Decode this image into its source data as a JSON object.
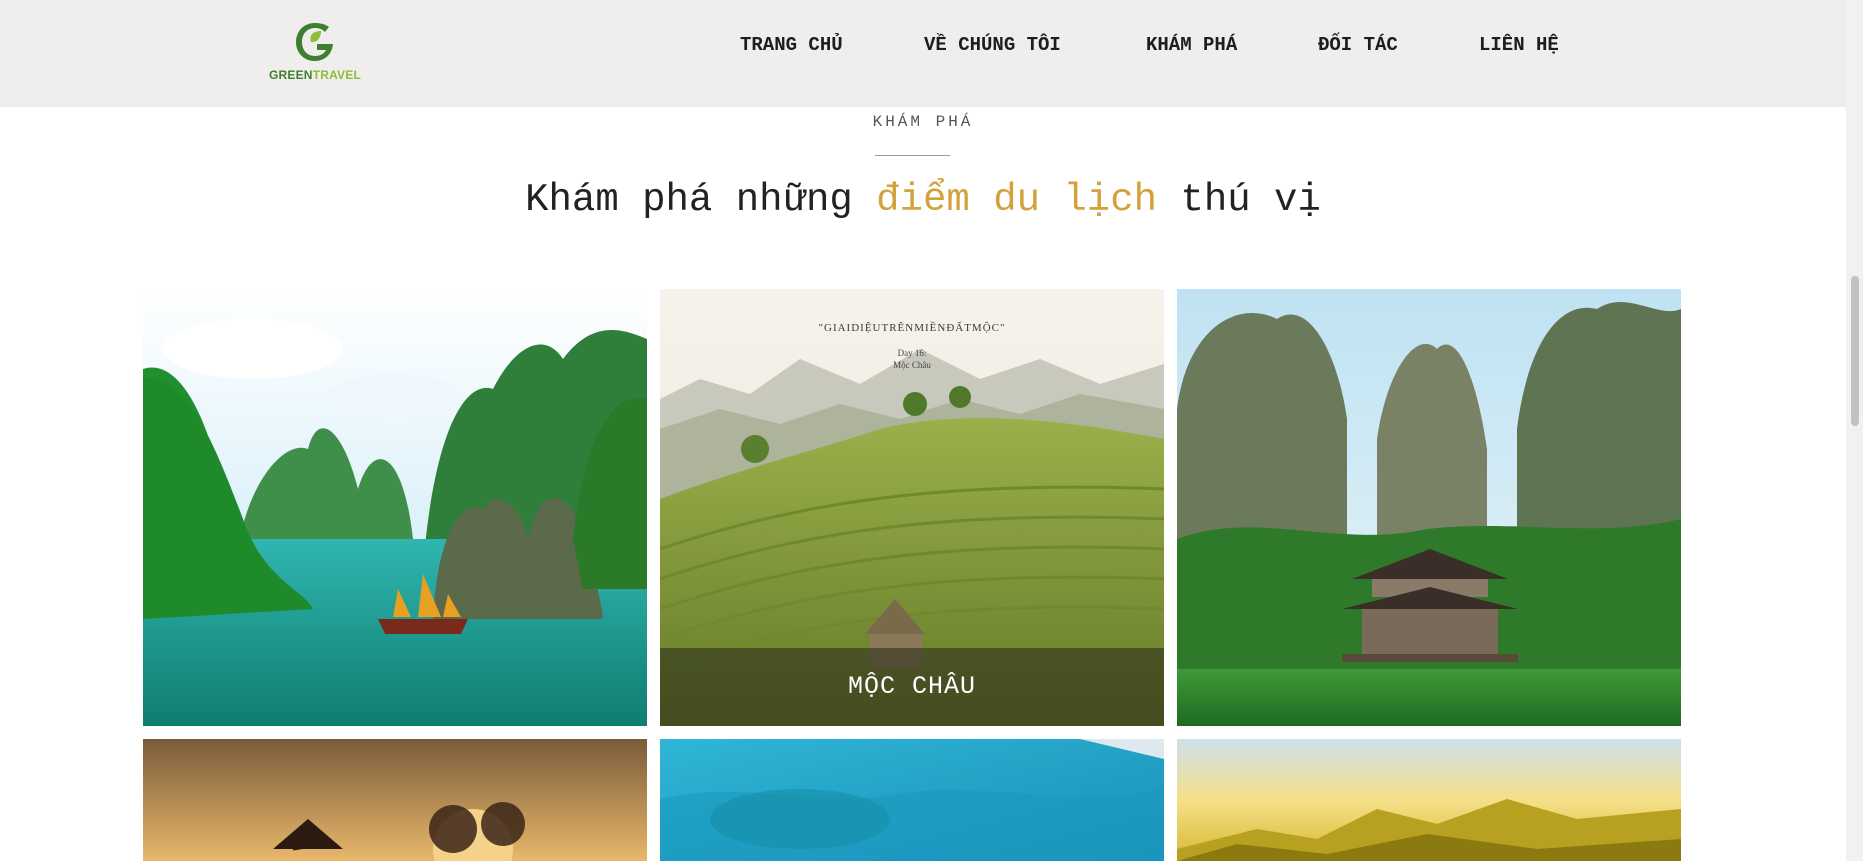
{
  "header": {
    "logo": {
      "letter": "G",
      "brand_part1": "GREEN",
      "brand_part2": "TRAVEL"
    },
    "nav": [
      "TRANG CHỦ",
      "VỀ CHÚNG TÔI",
      "KHÁM PHÁ",
      "ĐỐI TÁC",
      "LIÊN HỆ"
    ]
  },
  "section": {
    "eyebrow": "KHÁM PHÁ",
    "headline_before": "Khám phá những",
    "headline_accent": "điểm du lịch",
    "headline_after": "thú vị"
  },
  "cards": [
    {
      "scene": "halong-bay"
    },
    {
      "scene": "moc-chau",
      "caption": "MỘC CHÂU",
      "poster_title": "\"GIAIDIỆUTRÊNMIỀNĐẤTMỘC\"",
      "poster_sub_1": "Day 16:",
      "poster_sub_2": "Mộc Châu"
    },
    {
      "scene": "trang-an-pagoda"
    },
    {
      "scene": "sunset-fishing"
    },
    {
      "scene": "turquoise-sea"
    },
    {
      "scene": "golden-mountains"
    }
  ],
  "colors": {
    "accent": "#d4a23a",
    "header_bg": "#f0eeec",
    "brand_green": "#3f7f2f"
  }
}
